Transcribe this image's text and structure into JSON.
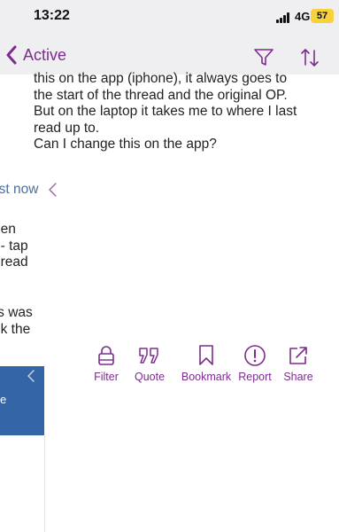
{
  "status_bar": {
    "time": "13:22",
    "network": "4G",
    "battery": "57"
  },
  "nav": {
    "back_label": "Active"
  },
  "post": {
    "lines": [
      "this on the app (iphone), it always goes to",
      "the start of the thread and the original OP.",
      "But on the laptop it takes me to where I last",
      "read up to.",
      "Can I change this on the app?"
    ],
    "timestamp": "ust now"
  },
  "snippets": {
    "block1": [
      "een",
      "t - tap",
      "hread"
    ],
    "block2": [
      "rs was",
      "ok the"
    ]
  },
  "actions": [
    {
      "label": "Filter",
      "icon": "lock-icon"
    },
    {
      "label": "Quote",
      "icon": "quote-icon"
    },
    {
      "label": "Bookmark",
      "icon": "bookmark-icon"
    },
    {
      "label": "Report",
      "icon": "report-icon"
    },
    {
      "label": "Share",
      "icon": "share-icon"
    }
  ],
  "panel": {
    "label": "e"
  },
  "colors": {
    "accent": "#7d2b8e",
    "link": "#4f6f9a",
    "panel": "#3465a6",
    "bar_bg": "#efeff1"
  }
}
